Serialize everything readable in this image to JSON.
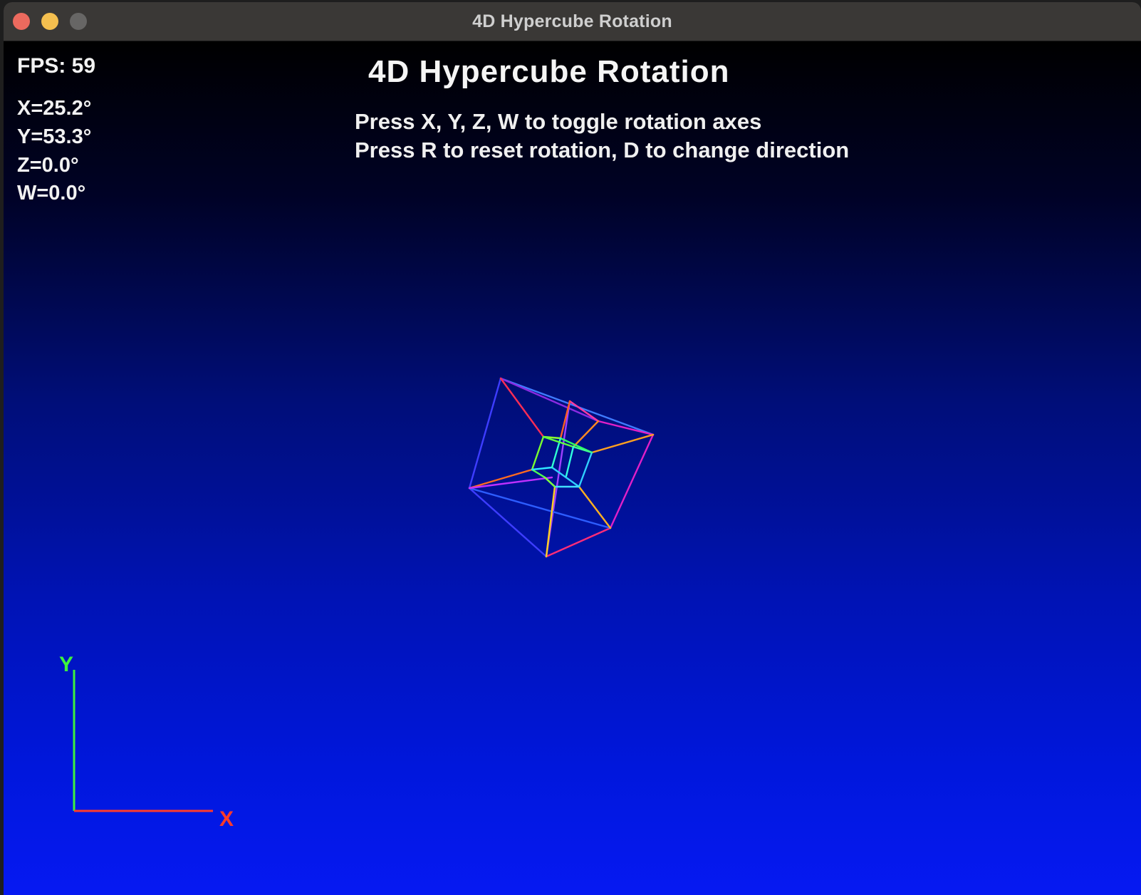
{
  "window": {
    "title": "4D Hypercube Rotation"
  },
  "hud": {
    "fps": "FPS: 59",
    "rotations": {
      "x": "X=25.2°",
      "y": "Y=53.3°",
      "z": "Z=0.0°",
      "w": "W=0.0°"
    }
  },
  "scene": {
    "title": "4D Hypercube Rotation",
    "help_line_1": "Press X, Y, Z, W to toggle rotation axes",
    "help_line_2": "Press R to reset rotation, D to change direction"
  },
  "axes": {
    "y_label": "Y",
    "x_label": "X",
    "y_color": "#3df23d",
    "x_color": "#ff3b2a"
  },
  "colors": {
    "close": "#ec6a5e",
    "minimize": "#f4bf4f",
    "zoom": "#676665"
  }
}
